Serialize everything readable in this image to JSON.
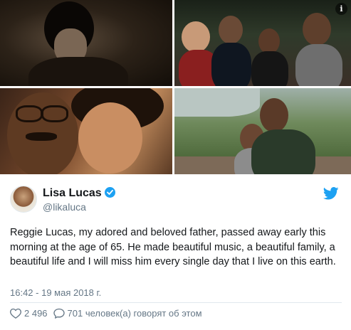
{
  "tweet": {
    "author_name": "Lisa Lucas",
    "author_handle": "@likaluca",
    "text": "Reggie Lucas, my adored and beloved father, passed away early this morning at the age of 65. He made beautiful music, a beautiful family, a beautiful life and I will miss him every single day that I live on this earth.",
    "timestamp": "16:42 - 19 мая 2018 г.",
    "likes": "2 496",
    "replies_text": "701 человек(а) говорят об этом"
  },
  "icons": {
    "verified": "verified-badge-icon",
    "bird": "twitter-bird-icon",
    "info": "info-icon",
    "heart": "heart-icon",
    "reply": "speech-bubble-icon"
  },
  "colors": {
    "accent": "#1da1f2",
    "secondary_text": "#657786",
    "primary_text": "#14171a"
  }
}
